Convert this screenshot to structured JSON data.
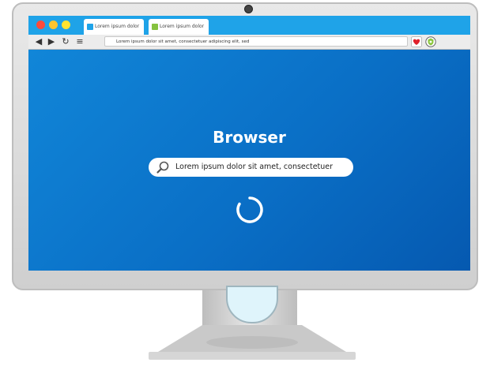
{
  "window": {
    "tabs": [
      {
        "label": "Lorem ipsum dolor",
        "color": "#1fa3e8"
      },
      {
        "label": "Lorem ipsum dolor",
        "color": "#86c23f"
      }
    ],
    "address_bar": {
      "url": "Lorem ipsum dolor sit amet, consectetuer adipiscing elit, sed"
    }
  },
  "page": {
    "title": "Browser",
    "search": {
      "value": "Lorem ipsum dolor sit amet, consectetuer"
    }
  },
  "colors": {
    "screen_blue": "#0a7bd1",
    "tabbar": "#1fa3e8",
    "heart": "#e0202a"
  }
}
